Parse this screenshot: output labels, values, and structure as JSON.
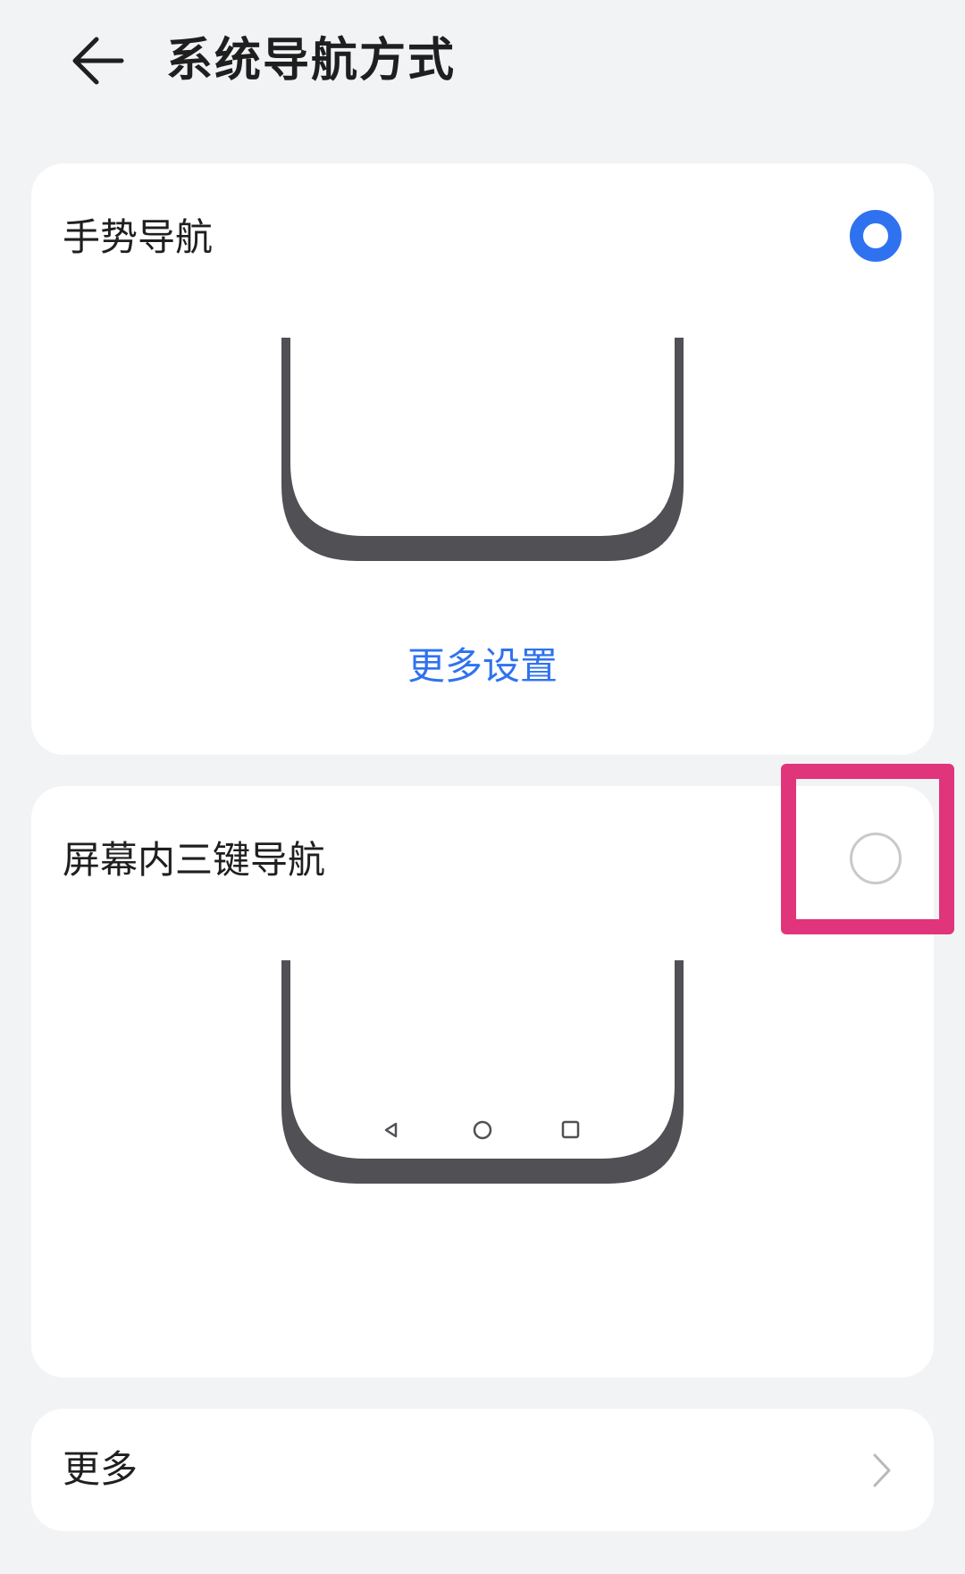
{
  "header": {
    "title": "系统导航方式",
    "back_icon": "arrow-left-icon"
  },
  "options": [
    {
      "label": "手势导航",
      "selected": true,
      "more_settings_label": "更多设置"
    },
    {
      "label": "屏幕内三键导航",
      "selected": false,
      "nav_keys": [
        "back-triangle-icon",
        "home-circle-icon",
        "recents-square-icon"
      ]
    }
  ],
  "more": {
    "label": "更多",
    "icon": "chevron-right-icon"
  },
  "colors": {
    "accent": "#2f72f0",
    "background": "#f1f3f5",
    "highlight": "#e0357a",
    "phone_frame": "#505055"
  }
}
